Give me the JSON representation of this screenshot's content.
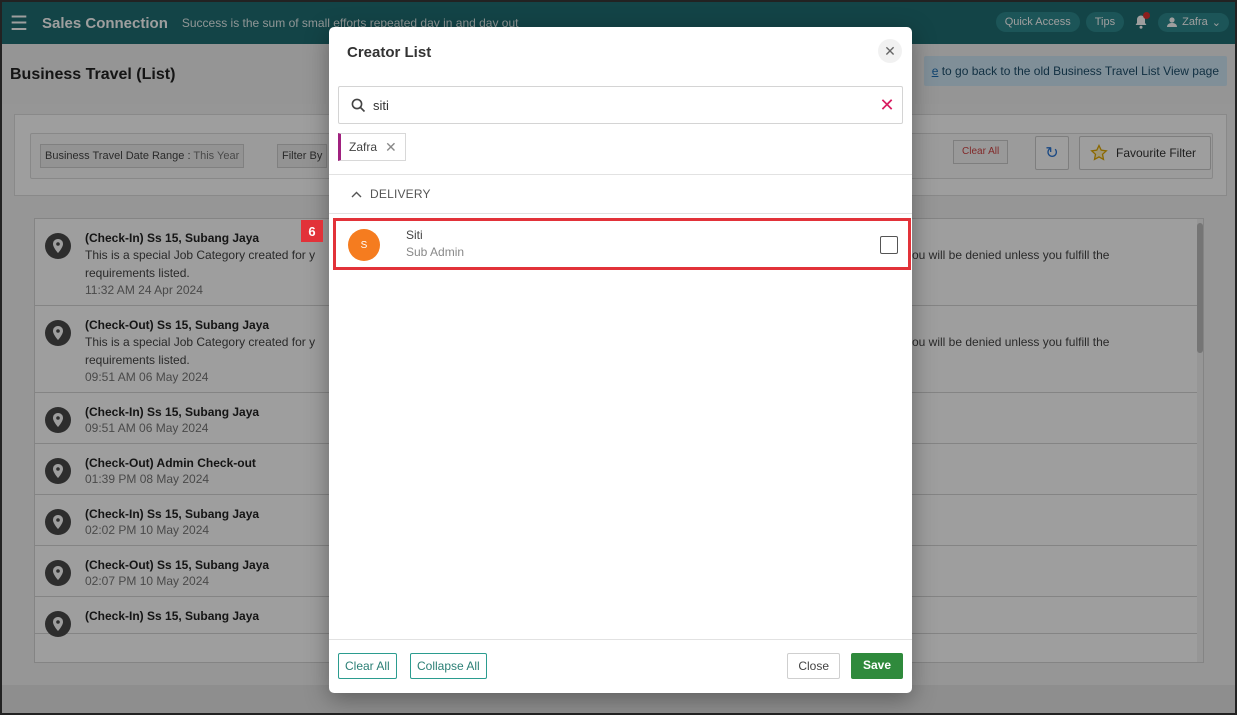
{
  "topbar": {
    "brand": "Sales Connection",
    "slogan": "Success is the sum of small efforts repeated day in and day out",
    "quick_access": "Quick Access",
    "tips": "Tips",
    "user": "Zafra"
  },
  "page": {
    "title": "Business Travel (List)",
    "notice_link": "e",
    "notice_text": " to go back to the old Business Travel List View page"
  },
  "filters": {
    "date_range_label": "Business Travel Date Range : ",
    "date_range_value": "This Year",
    "filter_by": "Filter By",
    "clear_all": "Clear All",
    "favourite_filter": "Favourite Filter"
  },
  "list": {
    "items": [
      {
        "title": "(Check-In) Ss 15, Subang Jaya",
        "desc": "This is a special Job Category created for y",
        "desc_tail": "ou will be denied unless you fulfill the",
        "desc2": "requirements listed.",
        "time": "11:32 AM  24 Apr 2024"
      },
      {
        "title": "(Check-Out) Ss 15, Subang Jaya",
        "desc": "This is a special Job Category created for y",
        "desc_tail": "ou will be denied unless you fulfill the",
        "desc2": "requirements listed.",
        "time": "09:51 AM  06 May 2024"
      },
      {
        "title": "(Check-In) Ss 15, Subang Jaya",
        "time": "09:51 AM  06 May 2024"
      },
      {
        "title": "(Check-Out) Admin Check-out",
        "time": "01:39 PM  08 May 2024"
      },
      {
        "title": "(Check-In) Ss 15, Subang Jaya",
        "time": "02:02 PM  10 May 2024"
      },
      {
        "title": "(Check-Out) Ss 15, Subang Jaya",
        "time": "02:07 PM  10 May 2024"
      },
      {
        "title": "(Check-In) Ss 15, Subang Jaya",
        "time": ""
      }
    ]
  },
  "modal": {
    "title": "Creator List",
    "search_value": "siti",
    "selected_tag": "Zafra",
    "group_label": "DELIVERY",
    "option": {
      "initial": "S",
      "name": "Siti",
      "role": "Sub Admin",
      "checked": false
    },
    "annotation_number": "6",
    "footer": {
      "clear_all": "Clear All",
      "collapse_all": "Collapse All",
      "close": "Close",
      "save": "Save"
    }
  },
  "colors": {
    "topbar": "#1f6f73",
    "avatar": "#f57c1f",
    "highlight": "#e23239",
    "save": "#2f8a3c",
    "tag_accent": "#a0217f"
  }
}
